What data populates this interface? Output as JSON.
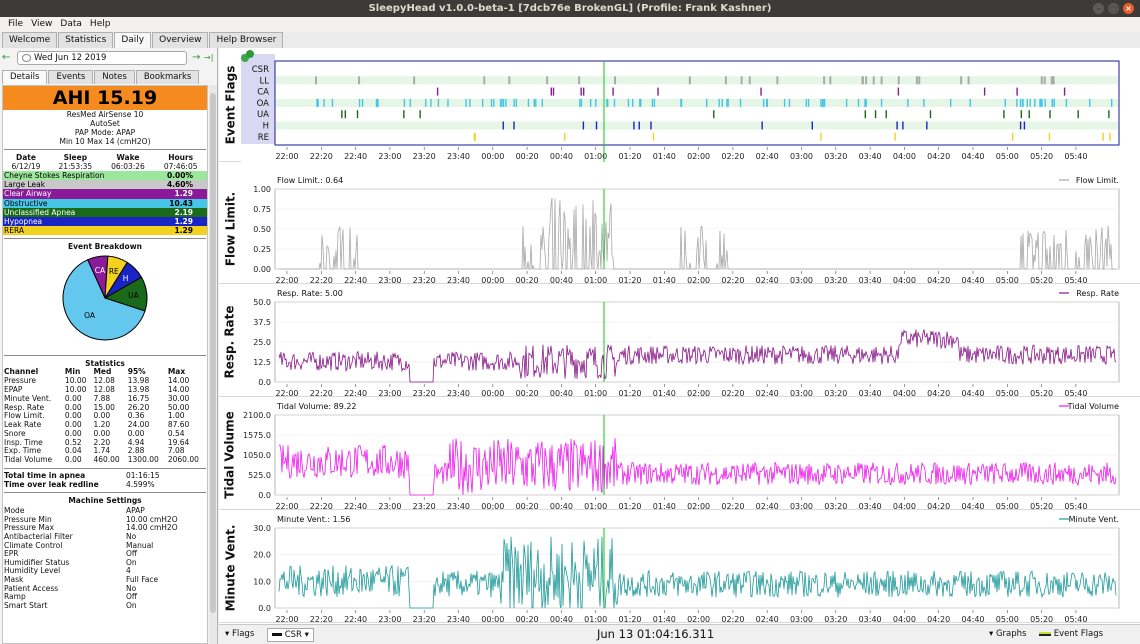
{
  "window": {
    "title": "SleepyHead v1.0.0-beta-1 [7dcb76e BrokenGL] (Profile: Frank Kashner)",
    "minimize": "–",
    "maximize": "□",
    "close": "×"
  },
  "menu": [
    "File",
    "View",
    "Data",
    "Help"
  ],
  "tabs": [
    "Welcome",
    "Statistics",
    "Daily",
    "Overview",
    "Help Browser"
  ],
  "active_tab": "Daily",
  "datebar": {
    "prev": "←",
    "date": "Wed Jun 12 2019",
    "next": "→",
    "end": "→|"
  },
  "subtabs": [
    "Details",
    "Events",
    "Notes",
    "Bookmarks"
  ],
  "ahi": "AHI 15.19",
  "machine": {
    "name": "ResMed AirSense 10",
    "mode": "AutoSet",
    "pap_mode": "PAP Mode: APAP",
    "pressure": "Min 10 Max 14 (cmH2O)"
  },
  "session": {
    "headers": [
      "Date",
      "Sleep",
      "Wake",
      "Hours"
    ],
    "values": [
      "6/12/19",
      "21:53:35",
      "06:03:26",
      "07:46:05"
    ]
  },
  "events": [
    {
      "name": "Cheyne Stokes Respiration",
      "value": "0.00%",
      "bg": "#9be79b",
      "fg": "#000000"
    },
    {
      "name": "Large Leak",
      "value": "4.60%",
      "bg": "#c8c8c8",
      "fg": "#000000"
    },
    {
      "name": "Clear Airway",
      "value": "1.29",
      "bg": "#8a1a9a",
      "fg": "#ffffff"
    },
    {
      "name": "Obstructive",
      "value": "10.43",
      "bg": "#46c6e6",
      "fg": "#000000"
    },
    {
      "name": "Unclassified Apnea",
      "value": "2.19",
      "bg": "#1a6a1a",
      "fg": "#ffffff"
    },
    {
      "name": "Hypopnea",
      "value": "1.29",
      "bg": "#1a24c4",
      "fg": "#ffffff"
    },
    {
      "name": "RERA",
      "value": "1.29",
      "bg": "#f2d21e",
      "fg": "#000000"
    }
  ],
  "pie": {
    "title": "Event Breakdown",
    "slices": [
      {
        "label": "OA",
        "value": 10.43,
        "color": "#64c8ee"
      },
      {
        "label": "CA",
        "value": 1.29,
        "color": "#8a1a9a"
      },
      {
        "label": "RE",
        "value": 1.29,
        "color": "#f2d21e"
      },
      {
        "label": "H",
        "value": 1.29,
        "color": "#1a24c4"
      },
      {
        "label": "UA",
        "value": 2.19,
        "color": "#1a6a1a"
      }
    ]
  },
  "statistics": {
    "title": "Statistics",
    "headers": [
      "Channel",
      "Min",
      "Med",
      "95%",
      "Max"
    ],
    "rows": [
      [
        "Pressure",
        "10.00",
        "12.08",
        "13.98",
        "14.00"
      ],
      [
        "EPAP",
        "10.00",
        "12.08",
        "13.98",
        "14.00"
      ],
      [
        "Minute Vent.",
        "0.00",
        "7.88",
        "16.75",
        "30.00"
      ],
      [
        "Resp. Rate",
        "0.00",
        "15.00",
        "26.20",
        "50.00"
      ],
      [
        "Flow Limit.",
        "0.00",
        "0.00",
        "0.36",
        "1.00"
      ],
      [
        "Leak Rate",
        "0.00",
        "1.20",
        "24.00",
        "87.60"
      ],
      [
        "Snore",
        "0.00",
        "0.00",
        "0.00",
        "0.54"
      ],
      [
        "Insp. Time",
        "0.52",
        "2.20",
        "4.94",
        "19.64"
      ],
      [
        "Exp. Time",
        "0.04",
        "1.74",
        "2.88",
        "7.08"
      ],
      [
        "Tidal Volume",
        "0.00",
        "460.00",
        "1300.00",
        "2060.00"
      ]
    ]
  },
  "totals": [
    {
      "label": "Total time in apnea",
      "value": "01:16:15"
    },
    {
      "label": "Time over leak redline",
      "value": "4.599%"
    }
  ],
  "machine_settings": {
    "title": "Machine Settings",
    "rows": [
      [
        "Mode",
        "APAP"
      ],
      [
        "Pressure Min",
        "10.00 cmH2O"
      ],
      [
        "Pressure Max",
        "14.00 cmH2O"
      ],
      [
        "Antibacterial Filter",
        "No"
      ],
      [
        "Climate Control",
        "Manual"
      ],
      [
        "EPR",
        "Off"
      ],
      [
        "Humidifier Status",
        "On"
      ],
      [
        "Humidity Level",
        "4"
      ],
      [
        "Mask",
        "Full Face"
      ],
      [
        "Patient Access",
        "No"
      ],
      [
        "Ramp",
        "Off"
      ],
      [
        "Smart Start",
        "On"
      ]
    ]
  },
  "time_ticks": [
    "22:00",
    "22:20",
    "22:40",
    "23:00",
    "23:20",
    "23:40",
    "00:00",
    "00:20",
    "00:40",
    "01:00",
    "01:20",
    "01:40",
    "02:00",
    "02:20",
    "02:40",
    "03:00",
    "03:20",
    "03:40",
    "04:00",
    "04:20",
    "04:40",
    "05:00",
    "05:20",
    "05:40"
  ],
  "flag_channels": [
    "CSR",
    "LL",
    "CA",
    "OA",
    "UA",
    "H",
    "RE"
  ],
  "graphs": {
    "event_flags": {
      "label": "Event Flags"
    },
    "flow_limit": {
      "label": "Flow Limit.",
      "readout": "Flow Limit.: 0.64",
      "legend": "Flow Limit.",
      "ticks": [
        "1.00",
        "0.75",
        "0.50",
        "0.25",
        "0.00"
      ],
      "color": "#a8a8a8"
    },
    "resp_rate": {
      "label": "Resp. Rate",
      "readout": "Resp. Rate: 5.00",
      "legend": "Resp. Rate",
      "ticks": [
        "50.0",
        "37.5",
        "25.0",
        "12.5",
        "0.0"
      ],
      "color": "#8a188a"
    },
    "tidal_volume": {
      "label": "Tidal Volume",
      "readout": "Tidal Volume: 89.22",
      "legend": "Tidal Volume",
      "ticks": [
        "2100.0",
        "1575.0",
        "1050.0",
        "525.0",
        "0.0"
      ],
      "color": "#ee1aee"
    },
    "minute_vent": {
      "label": "Minute Vent.",
      "readout": "Minute Vent.: 1.56",
      "legend": "Minute Vent.",
      "ticks": [
        "30.0",
        "20.0",
        "10.0",
        "0.0"
      ],
      "color": "#1e9a9a"
    }
  },
  "bottom": {
    "flags": "Flags",
    "csr": "CSR",
    "timestamp": "Jun 13 01:04:16.311",
    "graphs": "Graphs",
    "event_flags": "Event Flags"
  }
}
